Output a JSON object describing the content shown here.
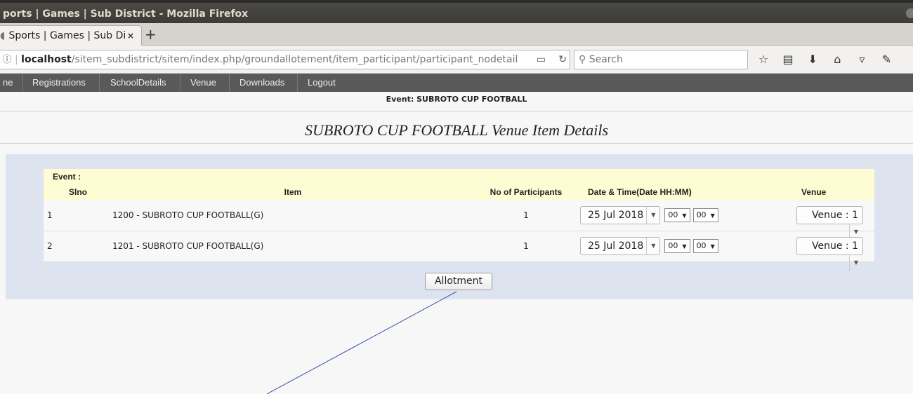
{
  "window": {
    "title": "ports | Games | Sub District - Mozilla Firefox"
  },
  "tab": {
    "label": "Sports | Games | Sub Di",
    "close": "×",
    "new_tab": "+"
  },
  "urlbar": {
    "host": "localhost",
    "path": "/sitem_subdistrict/sitem/index.php/groundallotement/item_participant/participant_nodetail"
  },
  "search": {
    "placeholder": "Search"
  },
  "menu": {
    "items": [
      "ne",
      "Registrations",
      "SchoolDetails",
      "Venue",
      "Downloads",
      "Logout"
    ]
  },
  "event_line": "Event: SUBROTO CUP FOOTBALL",
  "heading": "SUBROTO CUP FOOTBALL Venue Item Details",
  "table": {
    "event_label": "Event :",
    "headers": {
      "slno": "Slno",
      "item": "Item",
      "participants": "No of Participants",
      "datetime": "Date & Time(Date HH:MM)",
      "venue": "Venue"
    },
    "rows": [
      {
        "slno": "1",
        "item": "1200 - SUBROTO CUP FOOTBALL(G)",
        "participants": "1",
        "date": "25 Jul 2018",
        "hh": "00",
        "mm": "00",
        "venue": "Venue : 1"
      },
      {
        "slno": "2",
        "item": "1201 - SUBROTO CUP FOOTBALL(G)",
        "participants": "1",
        "date": "25 Jul 2018",
        "hh": "00",
        "mm": "00",
        "venue": "Venue : 1"
      }
    ]
  },
  "allotment_button": "Allotment",
  "colors": {
    "menu_bg": "#595959",
    "panel_bg": "#dde3ef",
    "header_bg": "#fefcd2",
    "annotation_line": "#3b4fa8"
  }
}
